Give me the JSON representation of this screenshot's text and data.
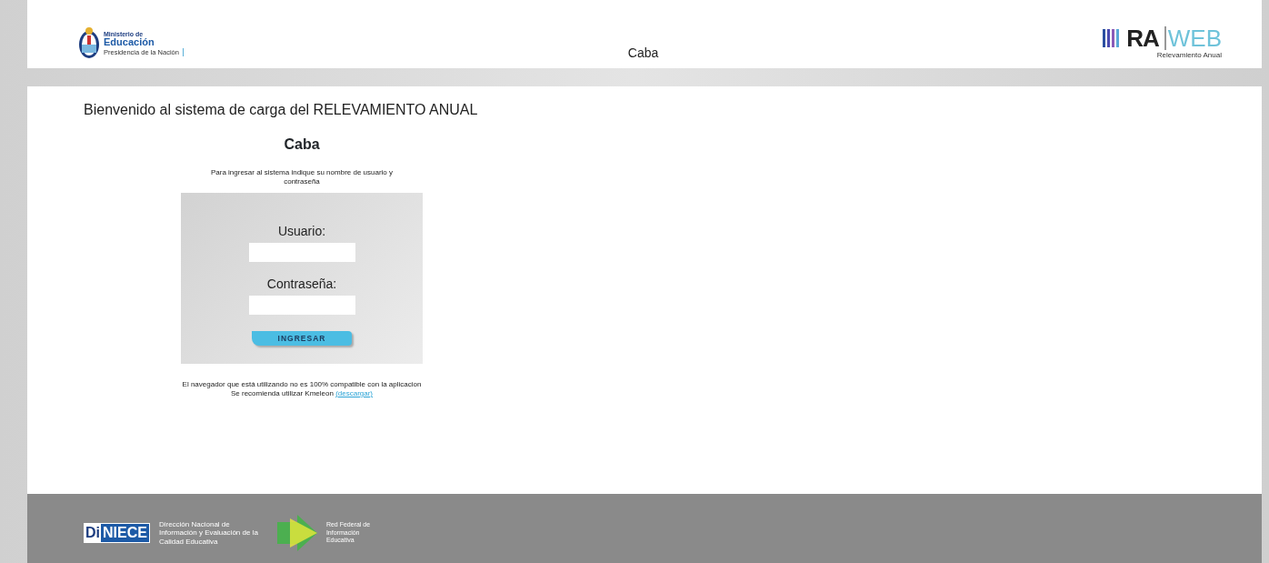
{
  "header": {
    "ministry": {
      "line1": "Ministerio de",
      "line2": "Educación",
      "line3": "Presidencia de la Nación"
    },
    "title": "Caba",
    "brand": {
      "part1": "RA",
      "part2": "WEB",
      "subtitle": "Relevamiento Anual"
    }
  },
  "welcome": "Bienvenido al sistema de carga del RELEVAMIENTO ANUAL",
  "jurisdiction": "Caba",
  "instructions": "Para ingresar al sistema indique su nombre de usuario y contraseña",
  "form": {
    "fields": [
      {
        "label": "Usuario:"
      },
      {
        "label": "Contraseña:"
      }
    ],
    "submit": "INGRESAR"
  },
  "notice": {
    "line1": "El navegador que está utilizando no es 100% compatible con la aplicacion",
    "line2": "Se recomienda utilizar Kmeleon",
    "link": "(descargar)"
  },
  "footer": {
    "diniece": {
      "part1": "Di",
      "part2": "NIECE",
      "caption": "Dirección Nacional de Información y Evaluación de la Calidad Educativa"
    },
    "red": "Red Federal de Información Educativa"
  }
}
